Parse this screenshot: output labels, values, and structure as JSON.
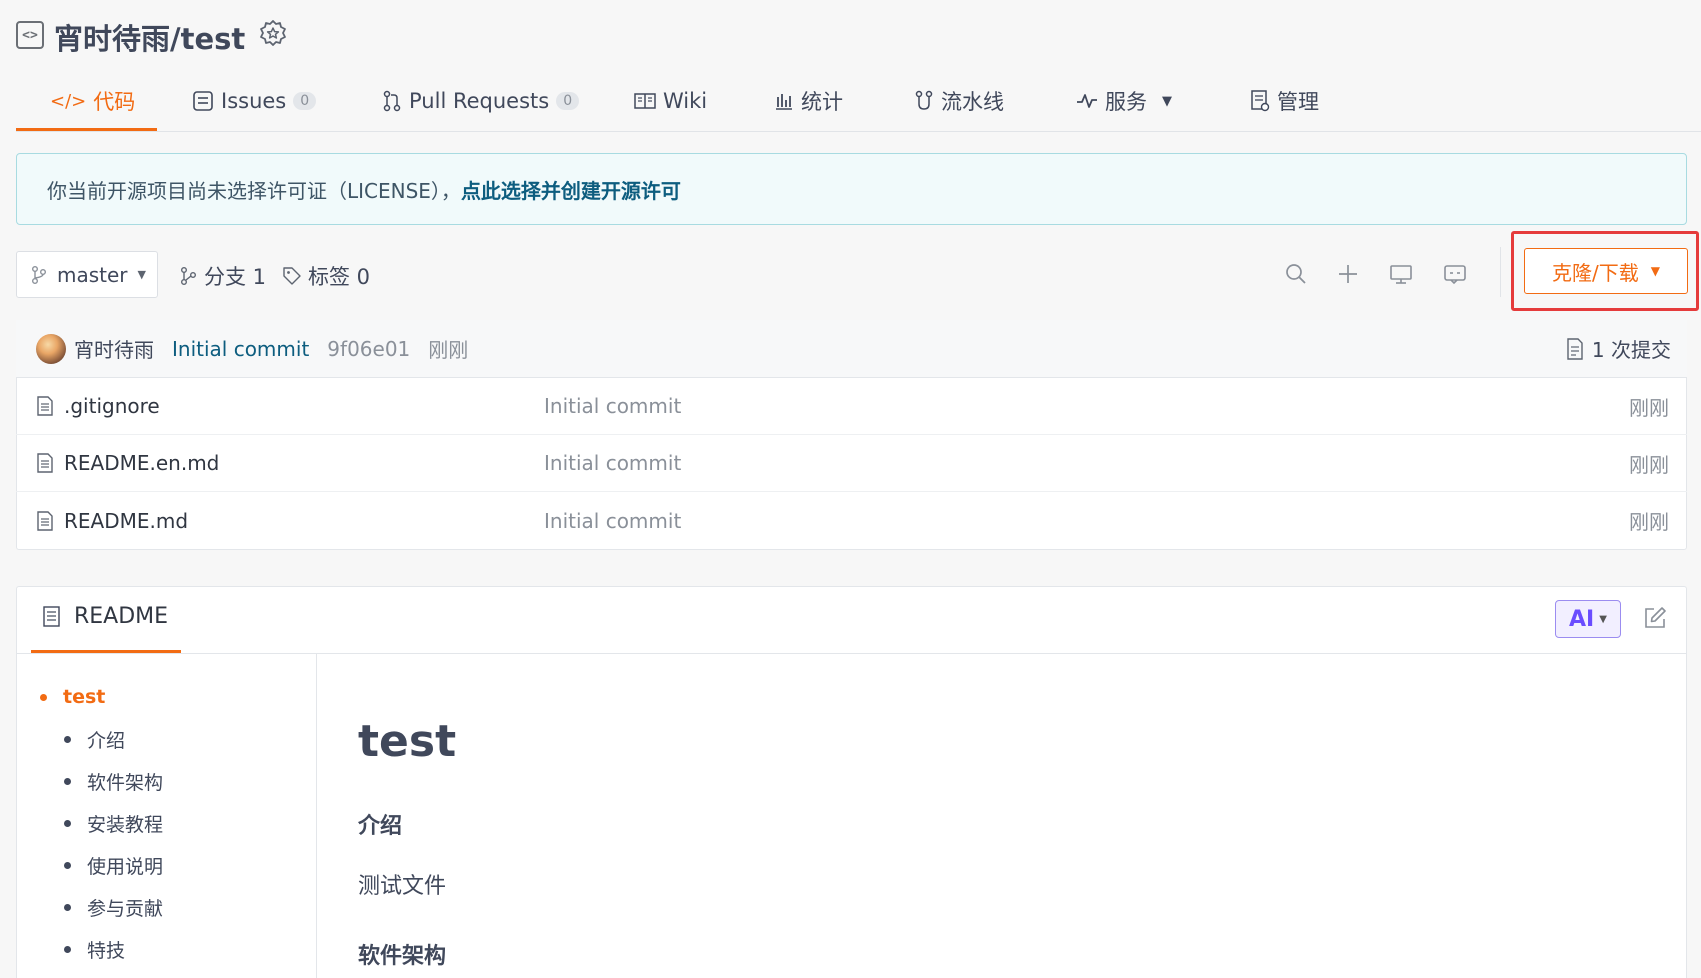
{
  "header": {
    "repo_title": "宵时待雨/test",
    "repo_icon": "code-repo-icon",
    "badge_icon": "award-badge-icon"
  },
  "tabs": [
    {
      "label": "代码",
      "icon": "code-icon",
      "active": true
    },
    {
      "label": "Issues",
      "icon": "issues-icon",
      "count": "0"
    },
    {
      "label": "Pull Requests",
      "icon": "pull-request-icon",
      "count": "0"
    },
    {
      "label": "Wiki",
      "icon": "wiki-book-icon"
    },
    {
      "label": "统计",
      "icon": "bar-chart-icon"
    },
    {
      "label": "流水线",
      "icon": "pipeline-icon"
    },
    {
      "label": "服务",
      "icon": "pulse-icon"
    },
    {
      "label": "管理",
      "icon": "manage-doc-icon"
    }
  ],
  "license_banner": {
    "text": "你当前开源项目尚未选择许可证（LICENSE），",
    "link": "点此选择并创建开源许可"
  },
  "branch_bar": {
    "branch": "master",
    "branches_label": "分支 1",
    "tags_label": "标签 0",
    "clone_label": "克隆/下载"
  },
  "last_commit": {
    "author": "宵时待雨",
    "message": "Initial commit",
    "sha": "9f06e01",
    "time": "刚刚",
    "count_label": "1 次提交"
  },
  "files": [
    {
      "name": ".gitignore",
      "commit": "Initial commit",
      "time": "刚刚"
    },
    {
      "name": "README.en.md",
      "commit": "Initial commit",
      "time": "刚刚"
    },
    {
      "name": "README.md",
      "commit": "Initial commit",
      "time": "刚刚"
    }
  ],
  "readme": {
    "tab_label": "README",
    "ai_label": "AI",
    "toc": [
      {
        "label": "test",
        "level": 1
      },
      {
        "label": "介绍",
        "level": 2
      },
      {
        "label": "软件架构",
        "level": 2
      },
      {
        "label": "安装教程",
        "level": 2
      },
      {
        "label": "使用说明",
        "level": 2
      },
      {
        "label": "参与贡献",
        "level": 2
      },
      {
        "label": "特技",
        "level": 2
      }
    ],
    "content": {
      "h1": "test",
      "h3_intro": "介绍",
      "intro_text": "测试文件",
      "h3_arch": "软件架构"
    }
  },
  "colors": {
    "accent": "#f26b13",
    "link": "#0d5d7f",
    "highlight_box": "#e53b3b",
    "ai_purple": "#6a4cff"
  }
}
